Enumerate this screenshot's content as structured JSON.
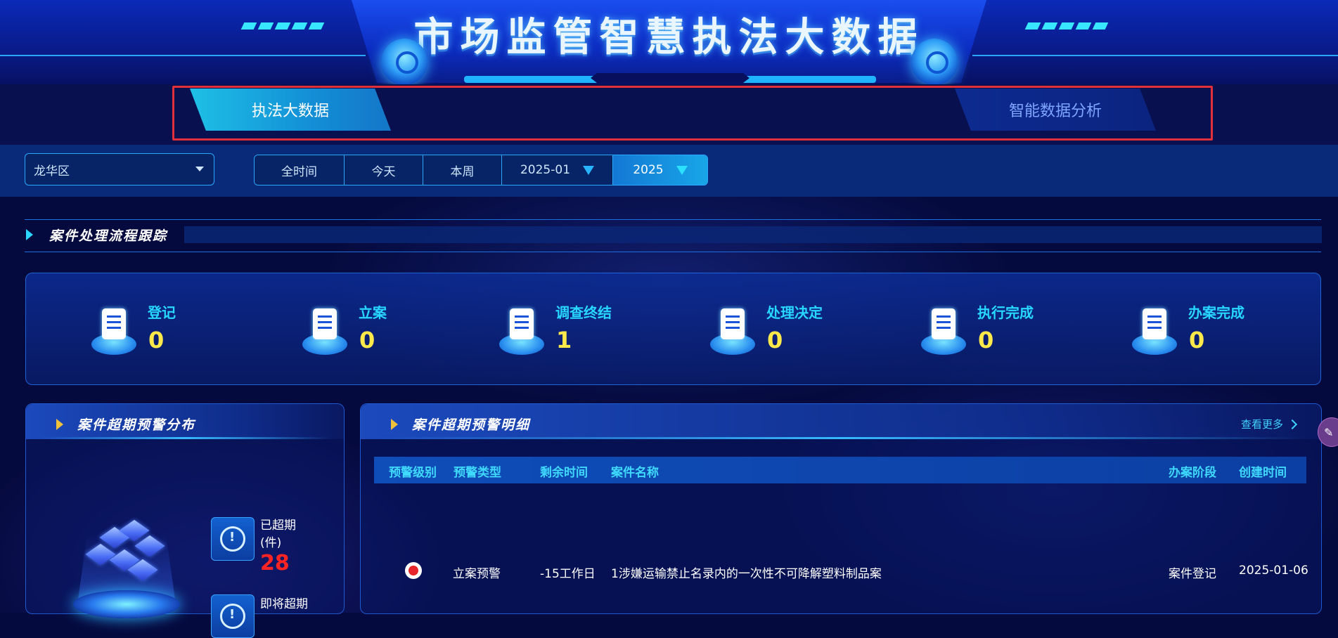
{
  "header": {
    "title": "市场监管智慧执法大数据"
  },
  "nav": {
    "tabs": [
      {
        "label": "执法大数据",
        "active": true
      },
      {
        "label": "智能数据分析",
        "active": false
      }
    ]
  },
  "filters": {
    "district": "龙华区",
    "segments": [
      {
        "label": "全时间"
      },
      {
        "label": "今天"
      },
      {
        "label": "本周"
      },
      {
        "label": "2025-01"
      },
      {
        "label": "2025",
        "active": true
      }
    ]
  },
  "flow_section": {
    "title": "案件处理流程跟踪",
    "steps": [
      {
        "label": "登记",
        "count": "0",
        "icon": "register-icon"
      },
      {
        "label": "立案",
        "count": "0",
        "icon": "file-case-icon"
      },
      {
        "label": "调查终结",
        "count": "1",
        "icon": "clipboard-icon"
      },
      {
        "label": "处理决定",
        "count": "0",
        "icon": "penalty-shield-icon"
      },
      {
        "label": "执行完成",
        "count": "0",
        "icon": "execution-icon"
      },
      {
        "label": "办案完成",
        "count": "0",
        "icon": "completed-icon"
      }
    ]
  },
  "overdue_distribution": {
    "title": "案件超期预警分布",
    "overdue_label": "已超期(件)",
    "overdue_count": "28",
    "upcoming_label": "即将超期"
  },
  "overdue_detail": {
    "title": "案件超期预警明细",
    "more": "查看更多",
    "columns": [
      "预警级别",
      "预警类型",
      "剩余时间",
      "案件名称",
      "办案阶段",
      "创建时间"
    ],
    "rows": [
      {
        "level_icon": "red-alarm-icon",
        "type": "立案预警",
        "remaining": "-15工作日",
        "name": "1涉嫌运输禁止名录内的一次性不可降解塑料制品案",
        "stage": "案件登记",
        "created": "2025-01-06"
      }
    ]
  },
  "colors": {
    "accent": "#27d7ff",
    "count": "#ffe94a",
    "overdue": "#ff2424",
    "highlight_box": "#e2303a"
  }
}
